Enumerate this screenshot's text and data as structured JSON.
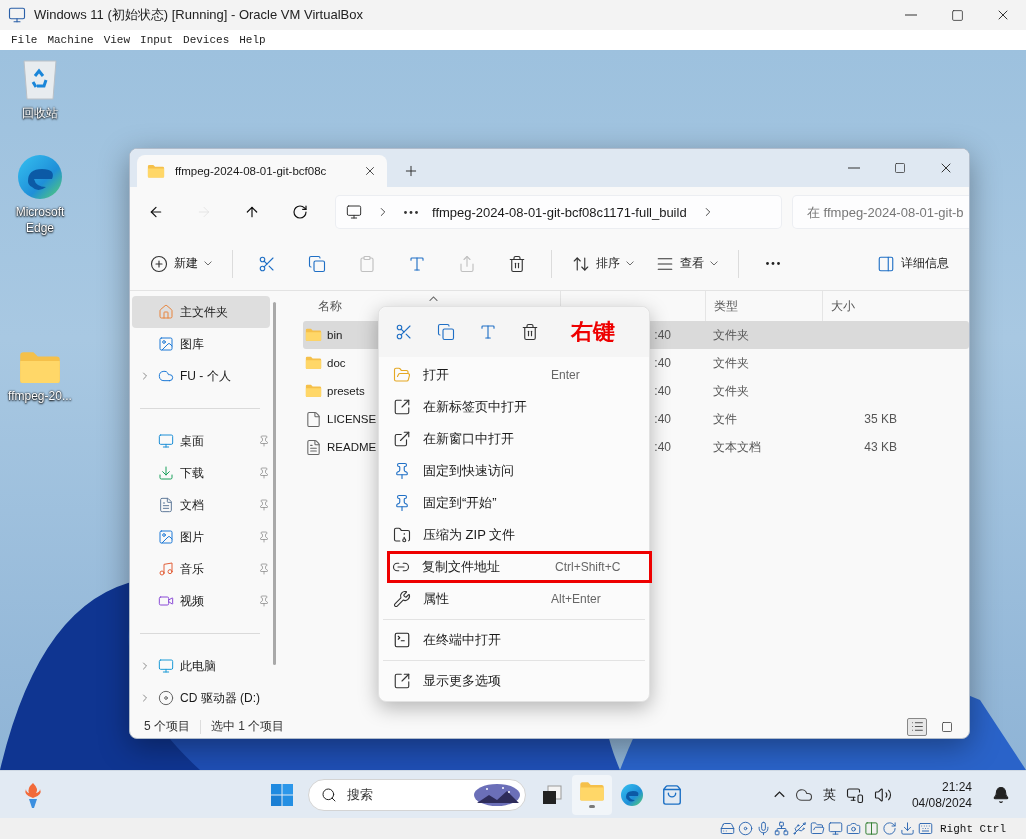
{
  "host_window": {
    "title": "Windows 11 (初始状态) [Running] - Oracle VM VirtualBox",
    "menu": [
      "File",
      "Machine",
      "View",
      "Input",
      "Devices",
      "Help"
    ]
  },
  "desktop_icons": [
    {
      "kind": "recycle-bin",
      "label": "回收站"
    },
    {
      "kind": "edge",
      "label": "Microsoft Edge"
    },
    {
      "kind": "folder",
      "label": "ffmpeg-20..."
    }
  ],
  "explorer": {
    "tabs": [
      {
        "title": "ffmpeg-2024-08-01-git-bcf08c",
        "selected": true
      }
    ],
    "nav": [
      {
        "kind": "back",
        "disabled": false
      },
      {
        "kind": "forward",
        "disabled": true
      },
      {
        "kind": "up",
        "disabled": false
      },
      {
        "kind": "refresh",
        "disabled": false
      }
    ],
    "address": {
      "path": "ffmpeg-2024-08-01-git-bcf08c1171-full_build"
    },
    "search": {
      "placeholder": "在 ffmpeg-2024-08-01-git-b"
    },
    "toolbar": [
      {
        "kind": "new",
        "label": "新建",
        "disabled": false
      },
      {
        "kind": "separator"
      },
      {
        "kind": "cut",
        "disabled": false
      },
      {
        "kind": "copy",
        "disabled": false
      },
      {
        "kind": "paste",
        "disabled": true
      },
      {
        "kind": "rename",
        "disabled": false
      },
      {
        "kind": "share",
        "disabled": true
      },
      {
        "kind": "delete",
        "disabled": false
      },
      {
        "kind": "separator"
      },
      {
        "kind": "sort",
        "label": "排序",
        "disabled": false
      },
      {
        "kind": "view",
        "label": "查看",
        "disabled": false
      },
      {
        "kind": "separator"
      },
      {
        "kind": "more",
        "disabled": false
      }
    ],
    "details_button": "详细信息",
    "sidebar": [
      {
        "items": [
          {
            "kind": "home",
            "label": "主文件夹",
            "selected": true,
            "pinned": false,
            "expandable": false
          },
          {
            "kind": "gallery",
            "label": "图库",
            "selected": false,
            "pinned": false,
            "expandable": false
          },
          {
            "kind": "onedrive",
            "label": "FU - 个人",
            "selected": false,
            "pinned": false,
            "expandable": true
          }
        ]
      },
      {
        "items": [
          {
            "kind": "desktop",
            "label": "桌面",
            "selected": false,
            "pinned": true,
            "expandable": false
          },
          {
            "kind": "downloads",
            "label": "下载",
            "selected": false,
            "pinned": true,
            "expandable": false
          },
          {
            "kind": "documents",
            "label": "文档",
            "selected": false,
            "pinned": true,
            "expandable": false
          },
          {
            "kind": "pictures",
            "label": "图片",
            "selected": false,
            "pinned": true,
            "expandable": false
          },
          {
            "kind": "music",
            "label": "音乐",
            "selected": false,
            "pinned": true,
            "expandable": false
          },
          {
            "kind": "videos",
            "label": "视频",
            "selected": false,
            "pinned": true,
            "expandable": false
          }
        ]
      },
      {
        "items": [
          {
            "kind": "pc",
            "label": "此电脑",
            "selected": false,
            "pinned": false,
            "expandable": true
          },
          {
            "kind": "cd",
            "label": "CD 驱动器 (D:)",
            "selected": false,
            "pinned": false,
            "expandable": true
          }
        ]
      }
    ],
    "columns": [
      "名称",
      "类型",
      "大小"
    ],
    "files": [
      {
        "kind": "folder",
        "name": "bin",
        "modified": ":40",
        "type": "文件夹",
        "selected": true
      },
      {
        "kind": "folder",
        "name": "doc",
        "modified": ":40",
        "type": "文件夹",
        "selected": false
      },
      {
        "kind": "folder",
        "name": "presets",
        "modified": ":40",
        "type": "文件夹",
        "selected": false
      },
      {
        "kind": "file",
        "name": "LICENSE",
        "modified": ":40",
        "type": "文件",
        "size": "35 KB",
        "selected": false
      },
      {
        "kind": "text",
        "name": "README",
        "modified": ":40",
        "type": "文本文档",
        "size": "43 KB",
        "selected": false
      }
    ],
    "status": {
      "count": "5 个项目",
      "selection": "选中 1 个项目"
    },
    "view_modes": [
      {
        "kind": "details",
        "selected": true
      },
      {
        "kind": "tiles",
        "selected": false
      }
    ]
  },
  "context_menu": {
    "quick_actions": [
      {
        "kind": "cut"
      },
      {
        "kind": "copy"
      },
      {
        "kind": "rename"
      },
      {
        "kind": "delete"
      }
    ],
    "annotation": "右键",
    "items": [
      {
        "kind": "open",
        "label": "打开",
        "shortcut": "Enter",
        "highlighted": false
      },
      {
        "kind": "new-tab",
        "label": "在新标签页中打开",
        "highlighted": false
      },
      {
        "kind": "new-window",
        "label": "在新窗口中打开",
        "highlighted": false
      },
      {
        "kind": "pin",
        "label": "固定到快速访问",
        "highlighted": false
      },
      {
        "kind": "pin",
        "label": "固定到“开始”",
        "highlighted": false
      },
      {
        "kind": "zip",
        "label": "压缩为 ZIP 文件",
        "highlighted": false
      },
      {
        "kind": "copy-path",
        "label": "复制文件地址",
        "shortcut": "Ctrl+Shift+C",
        "highlighted": true
      },
      {
        "kind": "properties",
        "label": "属性",
        "shortcut": "Alt+Enter",
        "highlighted": false
      },
      {
        "kind": "separator"
      },
      {
        "kind": "terminal",
        "label": "在终端中打开",
        "highlighted": false
      },
      {
        "kind": "separator"
      },
      {
        "kind": "more-options",
        "label": "显示更多选项",
        "highlighted": false
      }
    ]
  },
  "taskbar": {
    "search_placeholder": "搜索",
    "apps": [
      {
        "kind": "start",
        "running": false
      },
      {
        "kind": "task-view",
        "running": false
      },
      {
        "kind": "explorer",
        "running": true
      },
      {
        "kind": "edge",
        "running": false
      },
      {
        "kind": "store",
        "running": false
      }
    ],
    "ime": "英",
    "time": "21:24",
    "date": "04/08/2024"
  },
  "vbox_status": {
    "host_key": "Right Ctrl"
  }
}
